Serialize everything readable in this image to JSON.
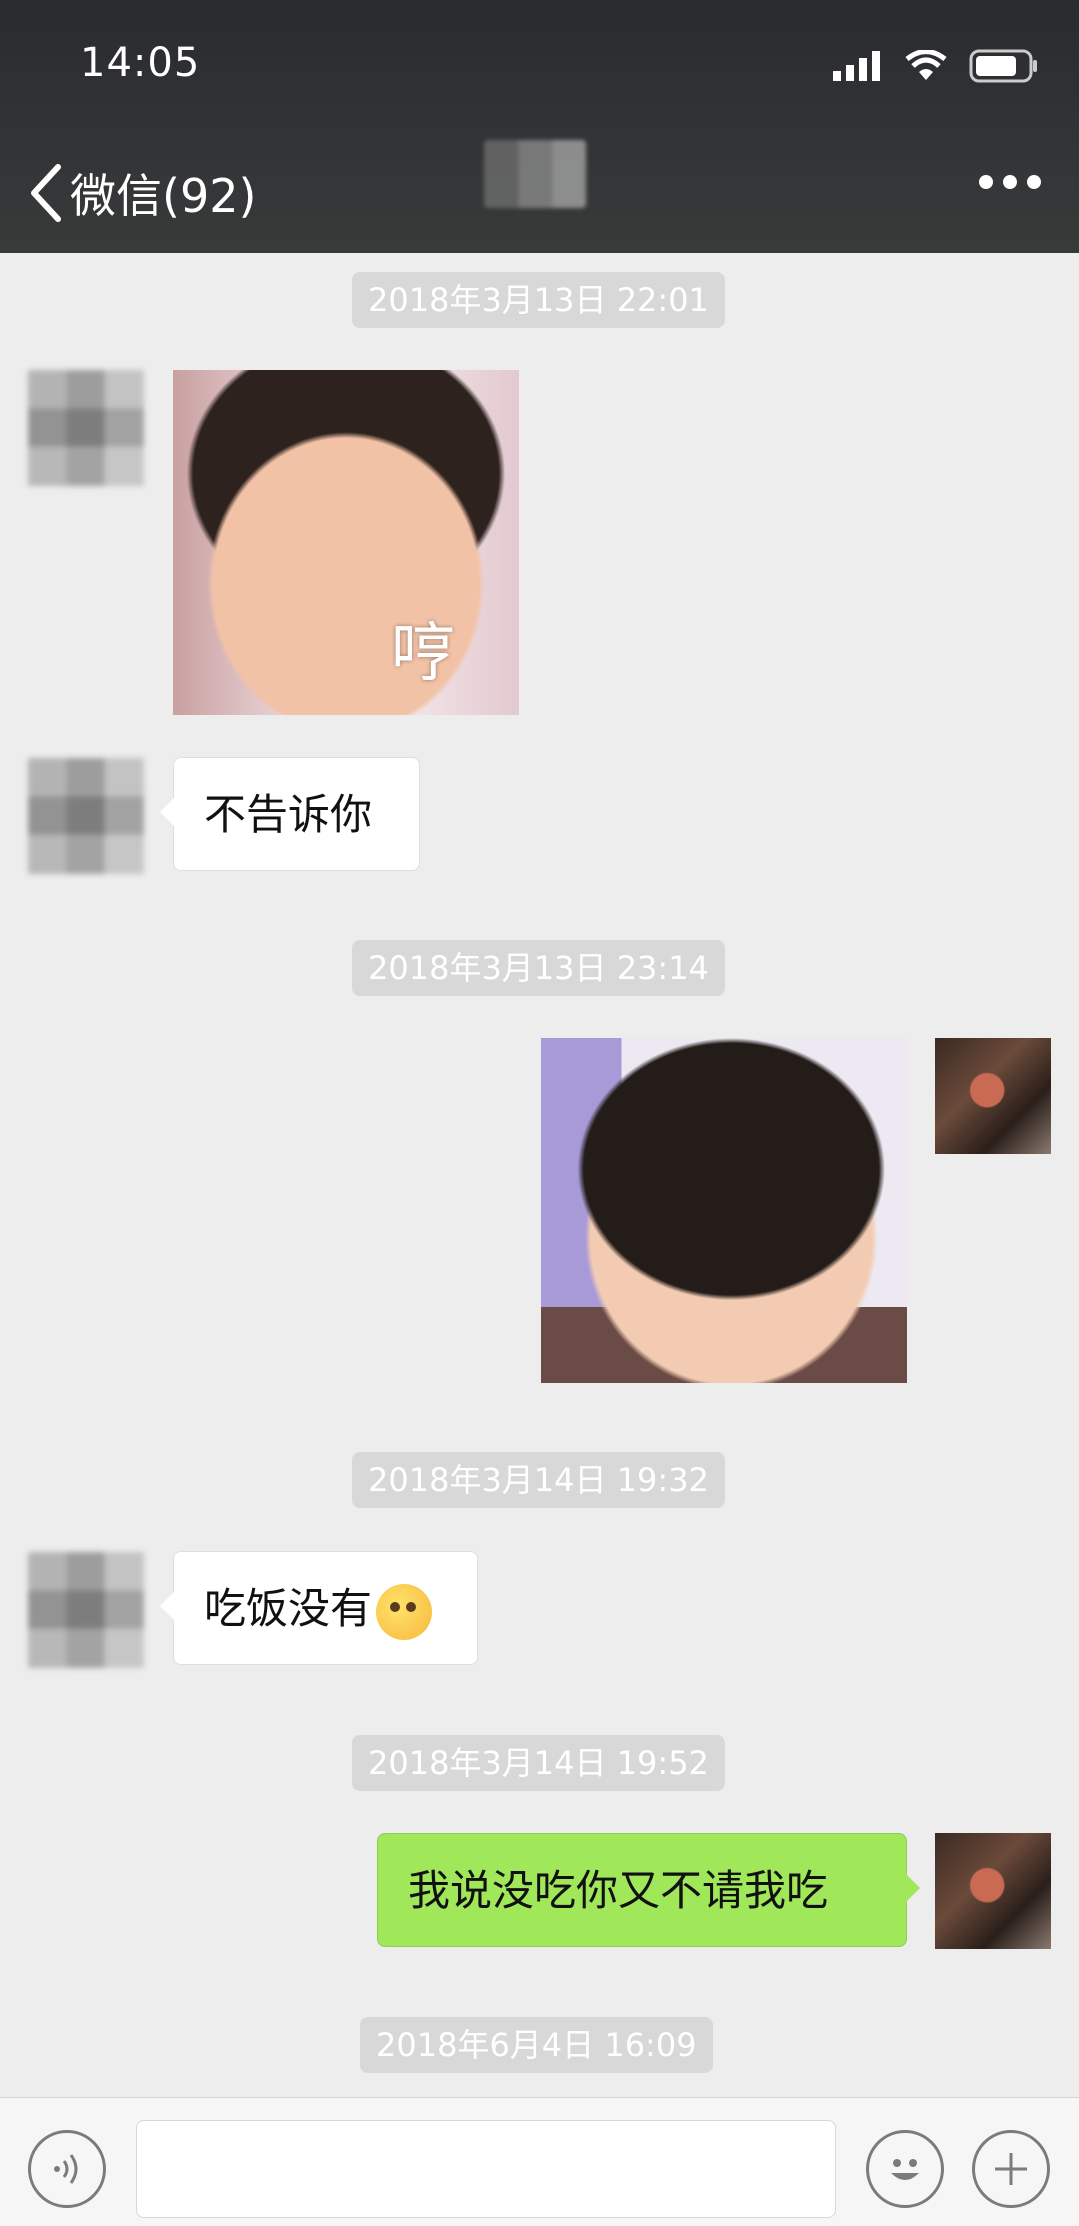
{
  "status_bar": {
    "time": "14:05"
  },
  "nav": {
    "back_label": "微信(92)"
  },
  "messages": [
    {
      "type": "timestamp",
      "text": "2018年3月13日 22:01"
    },
    {
      "type": "sticker",
      "side": "left",
      "caption": "哼"
    },
    {
      "type": "text",
      "side": "left",
      "text": "不告诉你"
    },
    {
      "type": "timestamp",
      "text": "2018年3月13日 23:14"
    },
    {
      "type": "sticker",
      "side": "right"
    },
    {
      "type": "timestamp",
      "text": "2018年3月14日 19:32"
    },
    {
      "type": "text",
      "side": "left",
      "text": "吃饭没有",
      "emoji": "smirk-emoji"
    },
    {
      "type": "timestamp",
      "text": "2018年3月14日 19:52"
    },
    {
      "type": "text",
      "side": "right",
      "text": "我说没吃你又不请我吃"
    },
    {
      "type": "timestamp",
      "text": "2018年6月4日 16:09"
    }
  ],
  "input": {
    "placeholder": ""
  },
  "colors": {
    "sent_bubble": "#a0e75a",
    "received_bubble": "#ffffff",
    "timestamp_bg": "#d8d8d8",
    "chat_bg": "#ededed"
  }
}
